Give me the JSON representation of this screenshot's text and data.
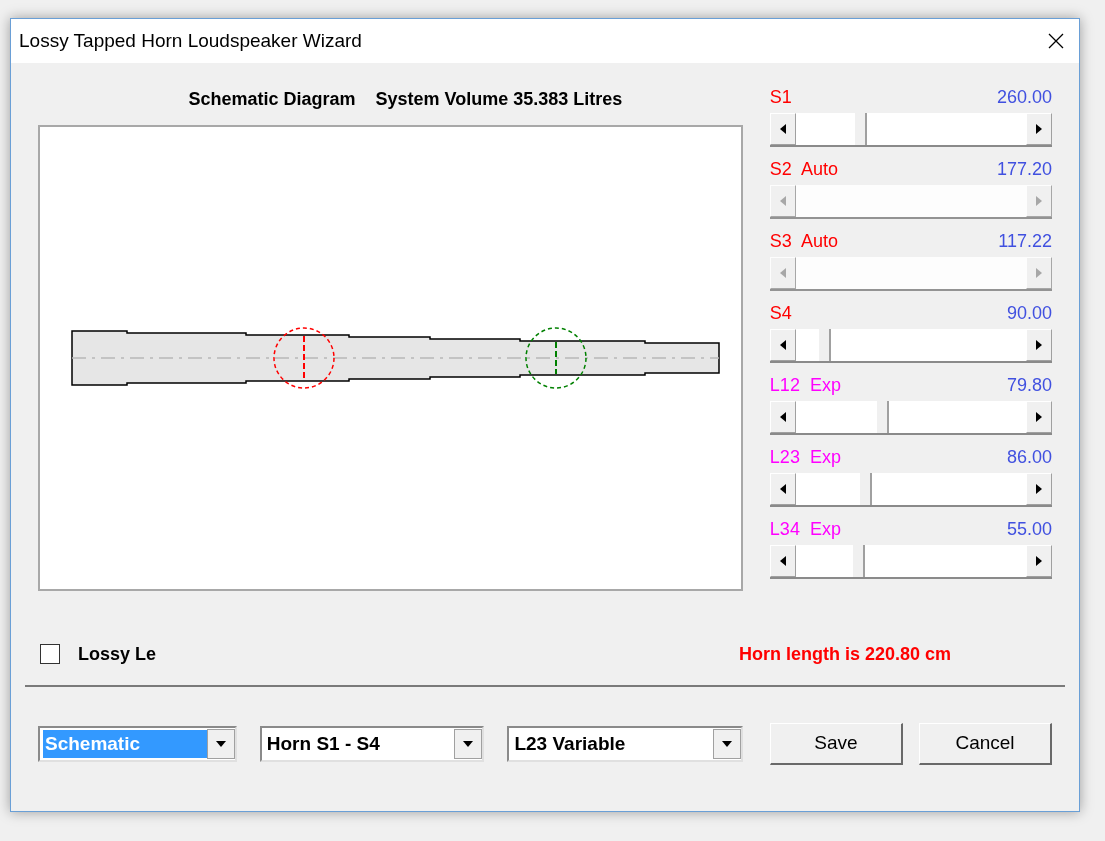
{
  "window": {
    "title": "Lossy Tapped Horn Loudspeaker Wizard"
  },
  "diagram": {
    "heading": "Schematic Diagram",
    "volume": "System Volume 35.383 Litres"
  },
  "parameters": [
    {
      "label": "S1",
      "value": "260.00",
      "color": "#ff0000",
      "disabled": false,
      "level": 0.27
    },
    {
      "label": "S2  Auto",
      "value": "177.20",
      "color": "#ff0000",
      "disabled": true
    },
    {
      "label": "S3  Auto",
      "value": "117.22",
      "color": "#ff0000",
      "disabled": true
    },
    {
      "label": "S4",
      "value": "90.00",
      "color": "#ff0000",
      "disabled": false,
      "level": 0.1
    },
    {
      "label": "L12  Exp",
      "value": "79.80",
      "color": "#ff00ff",
      "disabled": false,
      "level": 0.37
    },
    {
      "label": "L23  Exp",
      "value": "86.00",
      "color": "#ff00ff",
      "disabled": false,
      "level": 0.29
    },
    {
      "label": "L34  Exp",
      "value": "55.00",
      "color": "#ff00ff",
      "disabled": false,
      "level": 0.26
    }
  ],
  "lossy_le": {
    "label": "Lossy Le",
    "checked": false
  },
  "horn_length": "Horn length is 220.80 cm",
  "dropdowns": [
    {
      "value": "Schematic",
      "highlighted": true
    },
    {
      "value": "Horn S1 - S4",
      "highlighted": false
    },
    {
      "value": "L23 Variable",
      "highlighted": false
    }
  ],
  "buttons": [
    "Save",
    "Cancel"
  ]
}
